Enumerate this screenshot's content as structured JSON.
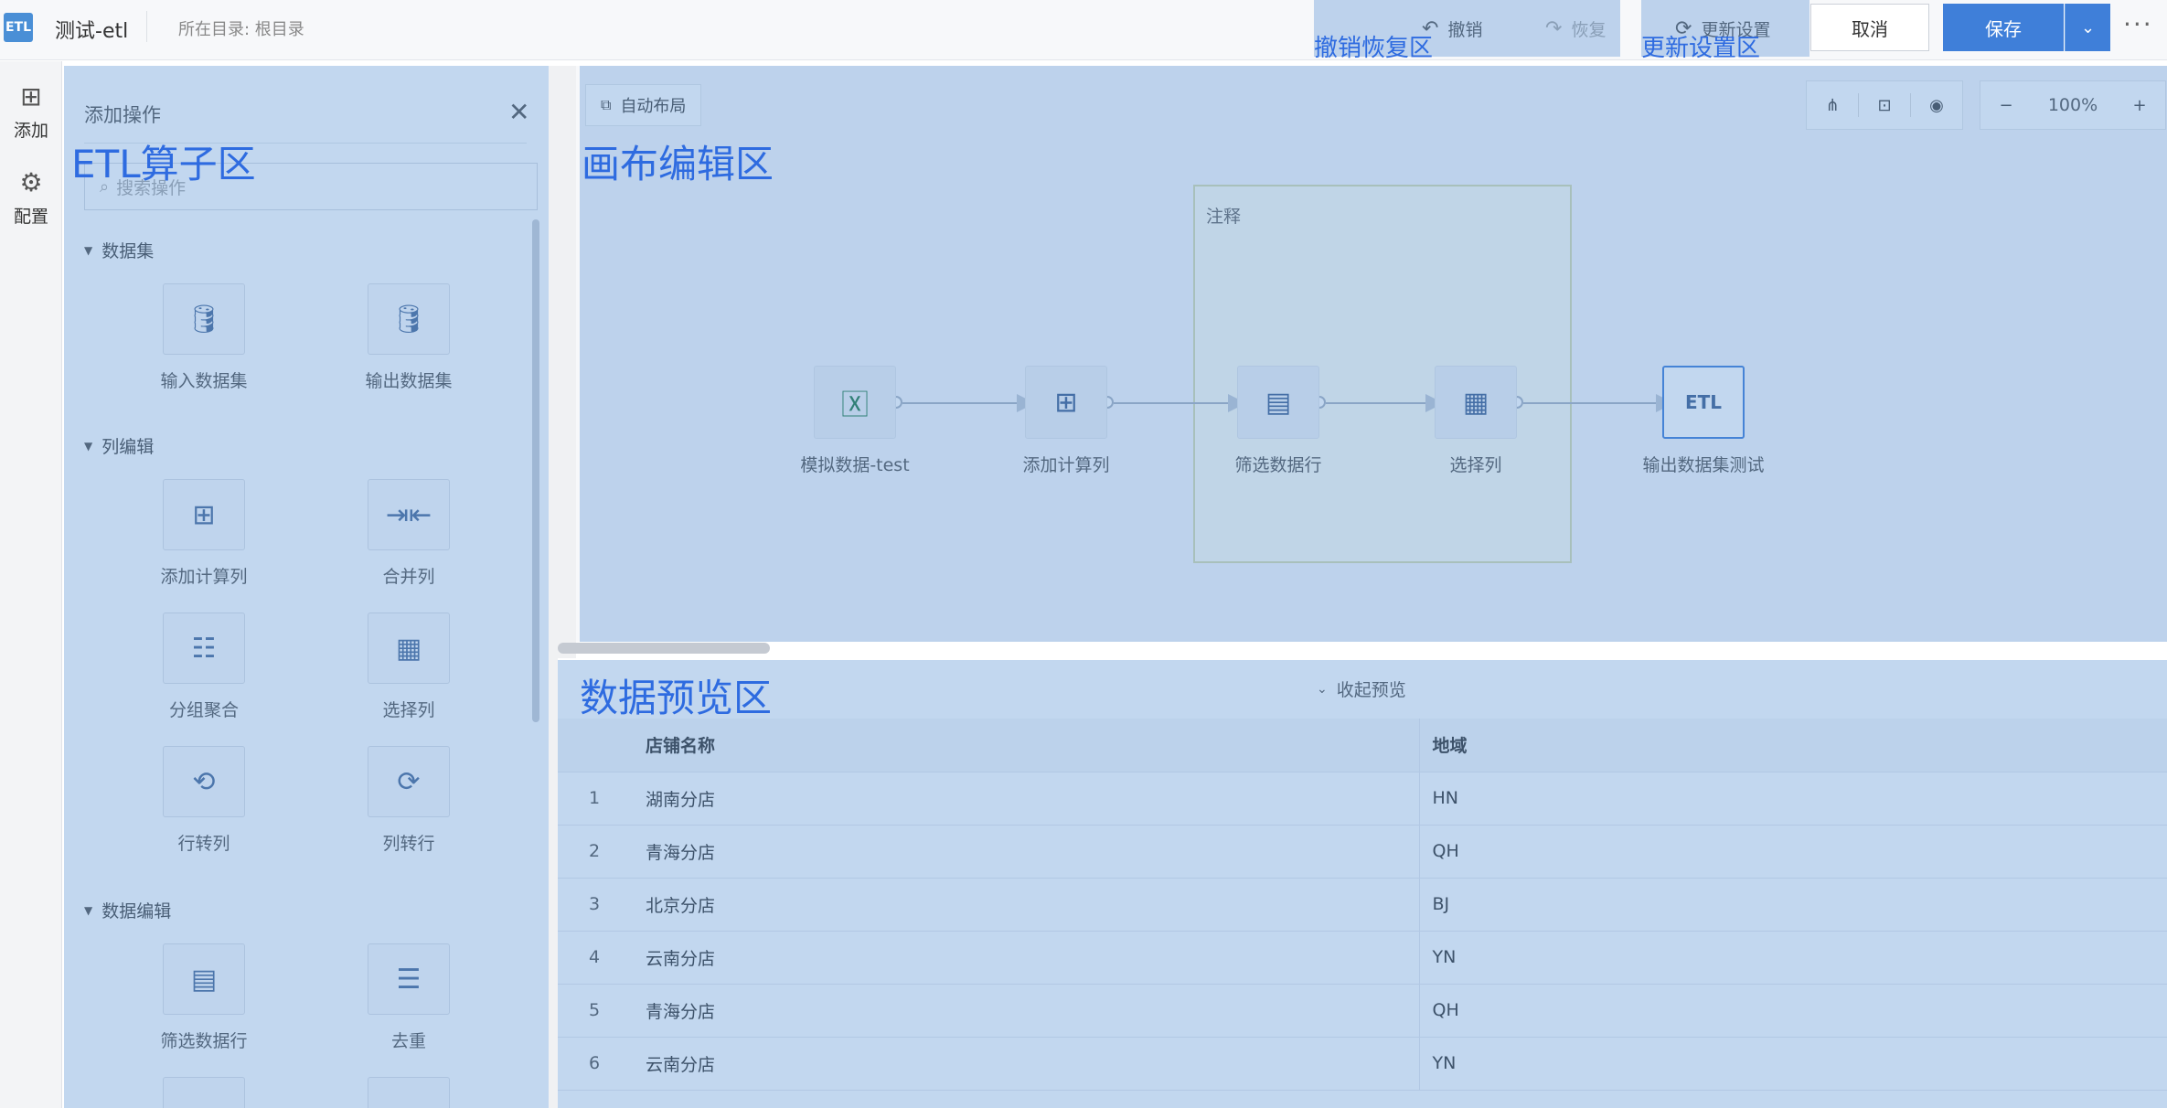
{
  "app": {
    "logo": "ETL",
    "title": "测试-etl",
    "directory": "所在目录: 根目录"
  },
  "toolbar": {
    "undo": "撤销",
    "redo": "恢复",
    "update_settings": "更新设置",
    "cancel": "取消",
    "save": "保存"
  },
  "rail": {
    "add": "添加",
    "config": "配置"
  },
  "panel": {
    "title": "添加操作",
    "search_placeholder": "搜索操作",
    "groups": [
      {
        "title": "数据集",
        "ops": [
          "输入数据集",
          "输出数据集"
        ]
      },
      {
        "title": "列编辑",
        "ops": [
          "添加计算列",
          "合并列",
          "分组聚合",
          "选择列",
          "行转列",
          "列转行"
        ]
      },
      {
        "title": "数据编辑",
        "ops": [
          "筛选数据行",
          "去重"
        ]
      }
    ]
  },
  "canvas": {
    "auto_layout": "自动布局",
    "zoom": "100%",
    "note_label": "注释",
    "nodes": [
      {
        "label": "模拟数据-test",
        "icon": "excel-icon"
      },
      {
        "label": "添加计算列",
        "icon": "calculator-icon"
      },
      {
        "label": "筛选数据行",
        "icon": "filter-rows-icon"
      },
      {
        "label": "选择列",
        "icon": "select-column-icon"
      },
      {
        "label": "输出数据集测试",
        "icon": "etl-dataset-icon"
      }
    ]
  },
  "preview": {
    "collapse": "收起预览",
    "columns": [
      "店铺名称",
      "地域"
    ],
    "rows": [
      {
        "idx": "1",
        "store": "湖南分店",
        "region": "HN"
      },
      {
        "idx": "2",
        "store": "青海分店",
        "region": "QH"
      },
      {
        "idx": "3",
        "store": "北京分店",
        "region": "BJ"
      },
      {
        "idx": "4",
        "store": "云南分店",
        "region": "YN"
      },
      {
        "idx": "5",
        "store": "青海分店",
        "region": "QH"
      },
      {
        "idx": "6",
        "store": "云南分店",
        "region": "YN"
      }
    ]
  },
  "annotations": {
    "etl_zone": "ETL算子区",
    "canvas_zone": "画布编辑区",
    "preview_zone": "数据预览区",
    "undo_zone": "撤销恢复区",
    "settings_zone": "更新设置区"
  },
  "colors": {
    "accent": "#3f7fd9",
    "overlay": "#508cd2",
    "annotation_text": "#2e6be0"
  }
}
